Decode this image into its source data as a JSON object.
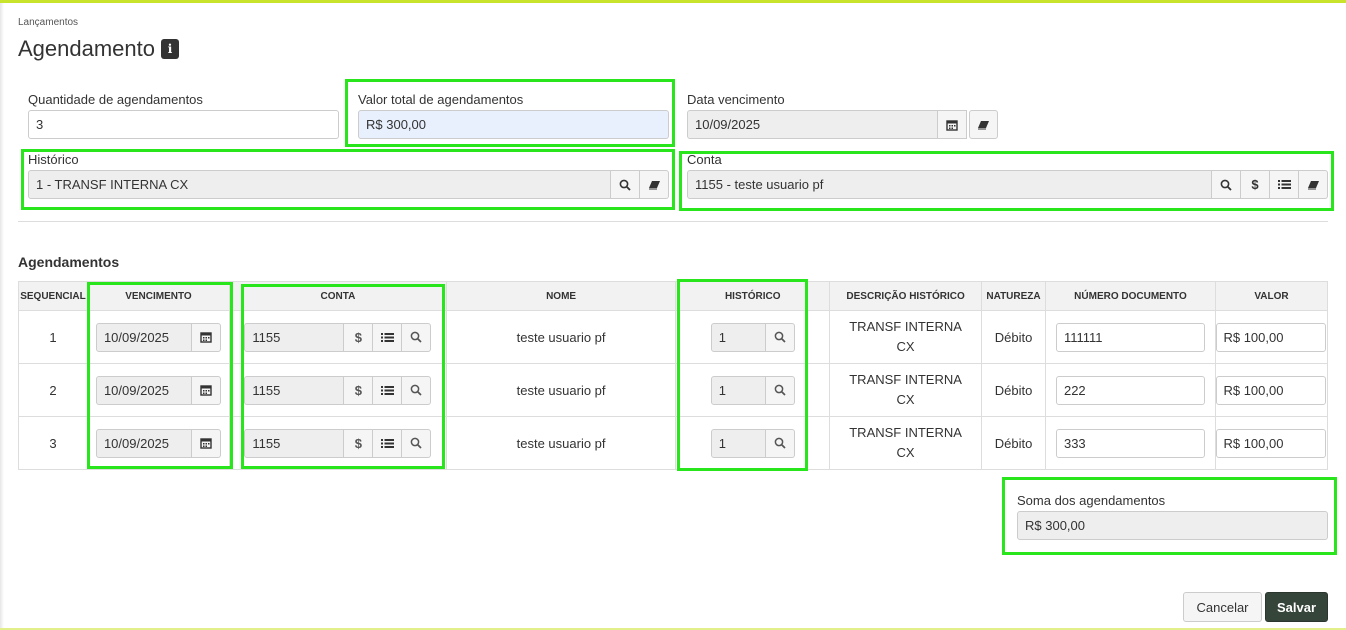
{
  "breadcrumb": "Lançamentos",
  "title": "Agendamento",
  "form": {
    "quantidade_label": "Quantidade de agendamentos",
    "quantidade_value": "3",
    "valor_total_label": "Valor total de agendamentos",
    "valor_total_value": "R$ 300,00",
    "data_vencimento_label": "Data vencimento",
    "data_vencimento_value": "10/09/2025",
    "historico_label": "Histórico",
    "historico_value": "1 - TRANSF INTERNA CX",
    "conta_label": "Conta",
    "conta_value": "1155 - teste usuario pf"
  },
  "section_title": "Agendamentos",
  "table": {
    "headers": [
      "SEQUENCIAL",
      "VENCIMENTO",
      "CONTA",
      "NOME",
      "HISTÓRICO",
      "DESCRIÇÃO HISTÓRICO",
      "NATUREZA",
      "NÚMERO DOCUMENTO",
      "VALOR"
    ],
    "rows": [
      {
        "seq": "1",
        "vencimento": "10/09/2025",
        "conta": "1155",
        "nome": "teste usuario pf",
        "historico": "1",
        "descricao": "TRANSF INTERNA CX",
        "natureza": "Débito",
        "documento": "111111",
        "valor": "R$ 100,00"
      },
      {
        "seq": "2",
        "vencimento": "10/09/2025",
        "conta": "1155",
        "nome": "teste usuario pf",
        "historico": "1",
        "descricao": "TRANSF INTERNA CX",
        "natureza": "Débito",
        "documento": "222",
        "valor": "R$ 100,00"
      },
      {
        "seq": "3",
        "vencimento": "10/09/2025",
        "conta": "1155",
        "nome": "teste usuario pf",
        "historico": "1",
        "descricao": "TRANSF INTERNA CX",
        "natureza": "Débito",
        "documento": "333",
        "valor": "R$ 100,00"
      }
    ]
  },
  "soma": {
    "label": "Soma dos agendamentos",
    "value": "R$ 300,00"
  },
  "buttons": {
    "cancel": "Cancelar",
    "save": "Salvar"
  },
  "icons": {
    "info": "i",
    "calendar": "calendar-icon",
    "eraser": "eraser-icon",
    "search": "search-icon",
    "dollar": "$",
    "list": "list-icon"
  },
  "colors": {
    "highlight_box": "#28e51c",
    "top_bar": "#c9e32c",
    "save_button": "#35453a"
  }
}
